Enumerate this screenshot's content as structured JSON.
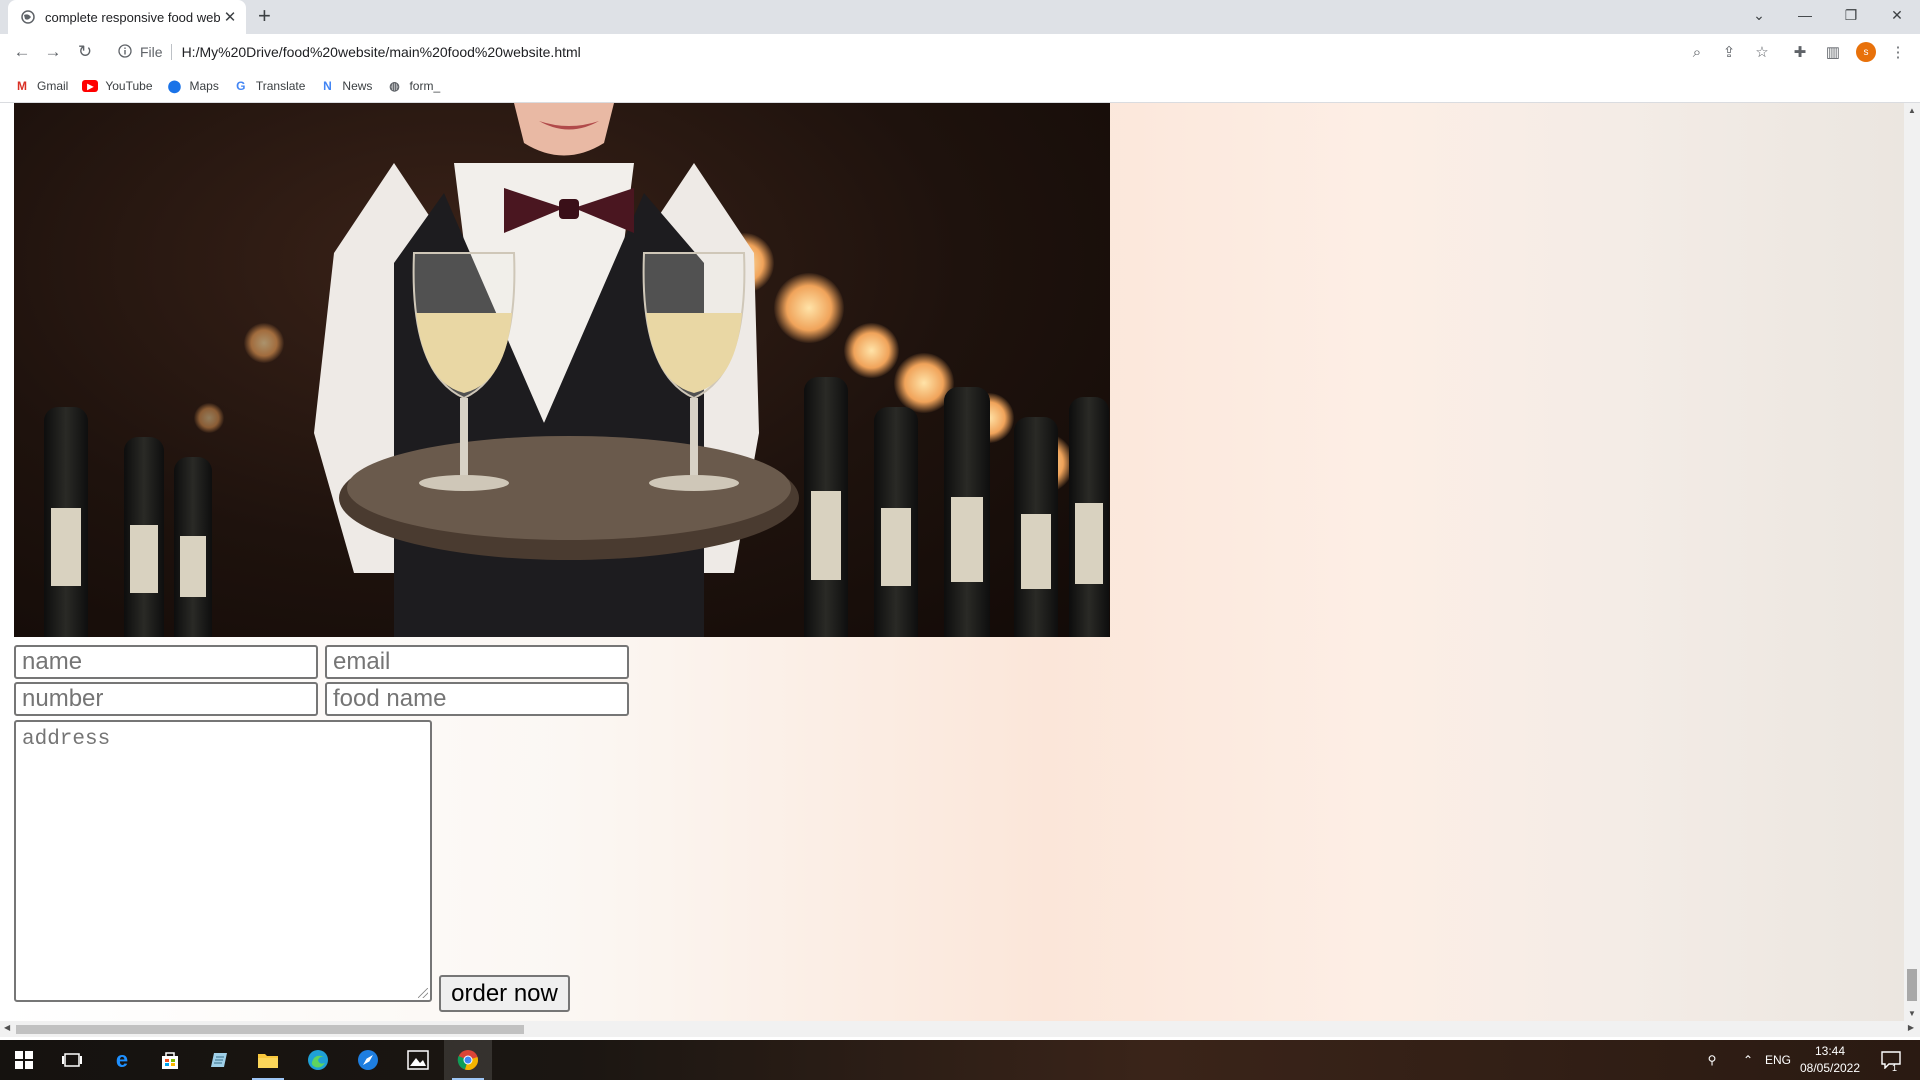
{
  "browser": {
    "tab_title": "complete responsive food websi",
    "tab_close": "✕",
    "new_tab": "+",
    "address_prefix": "File",
    "url": "H:/My%20Drive/food%20website/main%20food%20website.html",
    "profile_initial": "s",
    "bookmarks": [
      {
        "label": "Gmail",
        "icon": "gmail-icon",
        "color": "#d93025"
      },
      {
        "label": "YouTube",
        "icon": "youtube-icon",
        "color": "#ff0000"
      },
      {
        "label": "Maps",
        "icon": "maps-icon",
        "color": "#1a73e8"
      },
      {
        "label": "Translate",
        "icon": "translate-icon",
        "color": "#4285f4"
      },
      {
        "label": "News",
        "icon": "news-icon",
        "color": "#4285f4"
      },
      {
        "label": "form_",
        "icon": "globe-icon",
        "color": "#5f6368"
      }
    ]
  },
  "form": {
    "name_placeholder": "name",
    "email_placeholder": "email",
    "number_placeholder": "number",
    "food_placeholder": "food name",
    "address_placeholder": "address",
    "submit_label": "order now"
  },
  "taskbar": {
    "language": "ENG",
    "time": "13:44",
    "date": "08/05/2022",
    "notification_count": "1"
  },
  "colors": {
    "accent_profile": "#e8710a",
    "page_bg_peach": "#fbe6d9"
  }
}
